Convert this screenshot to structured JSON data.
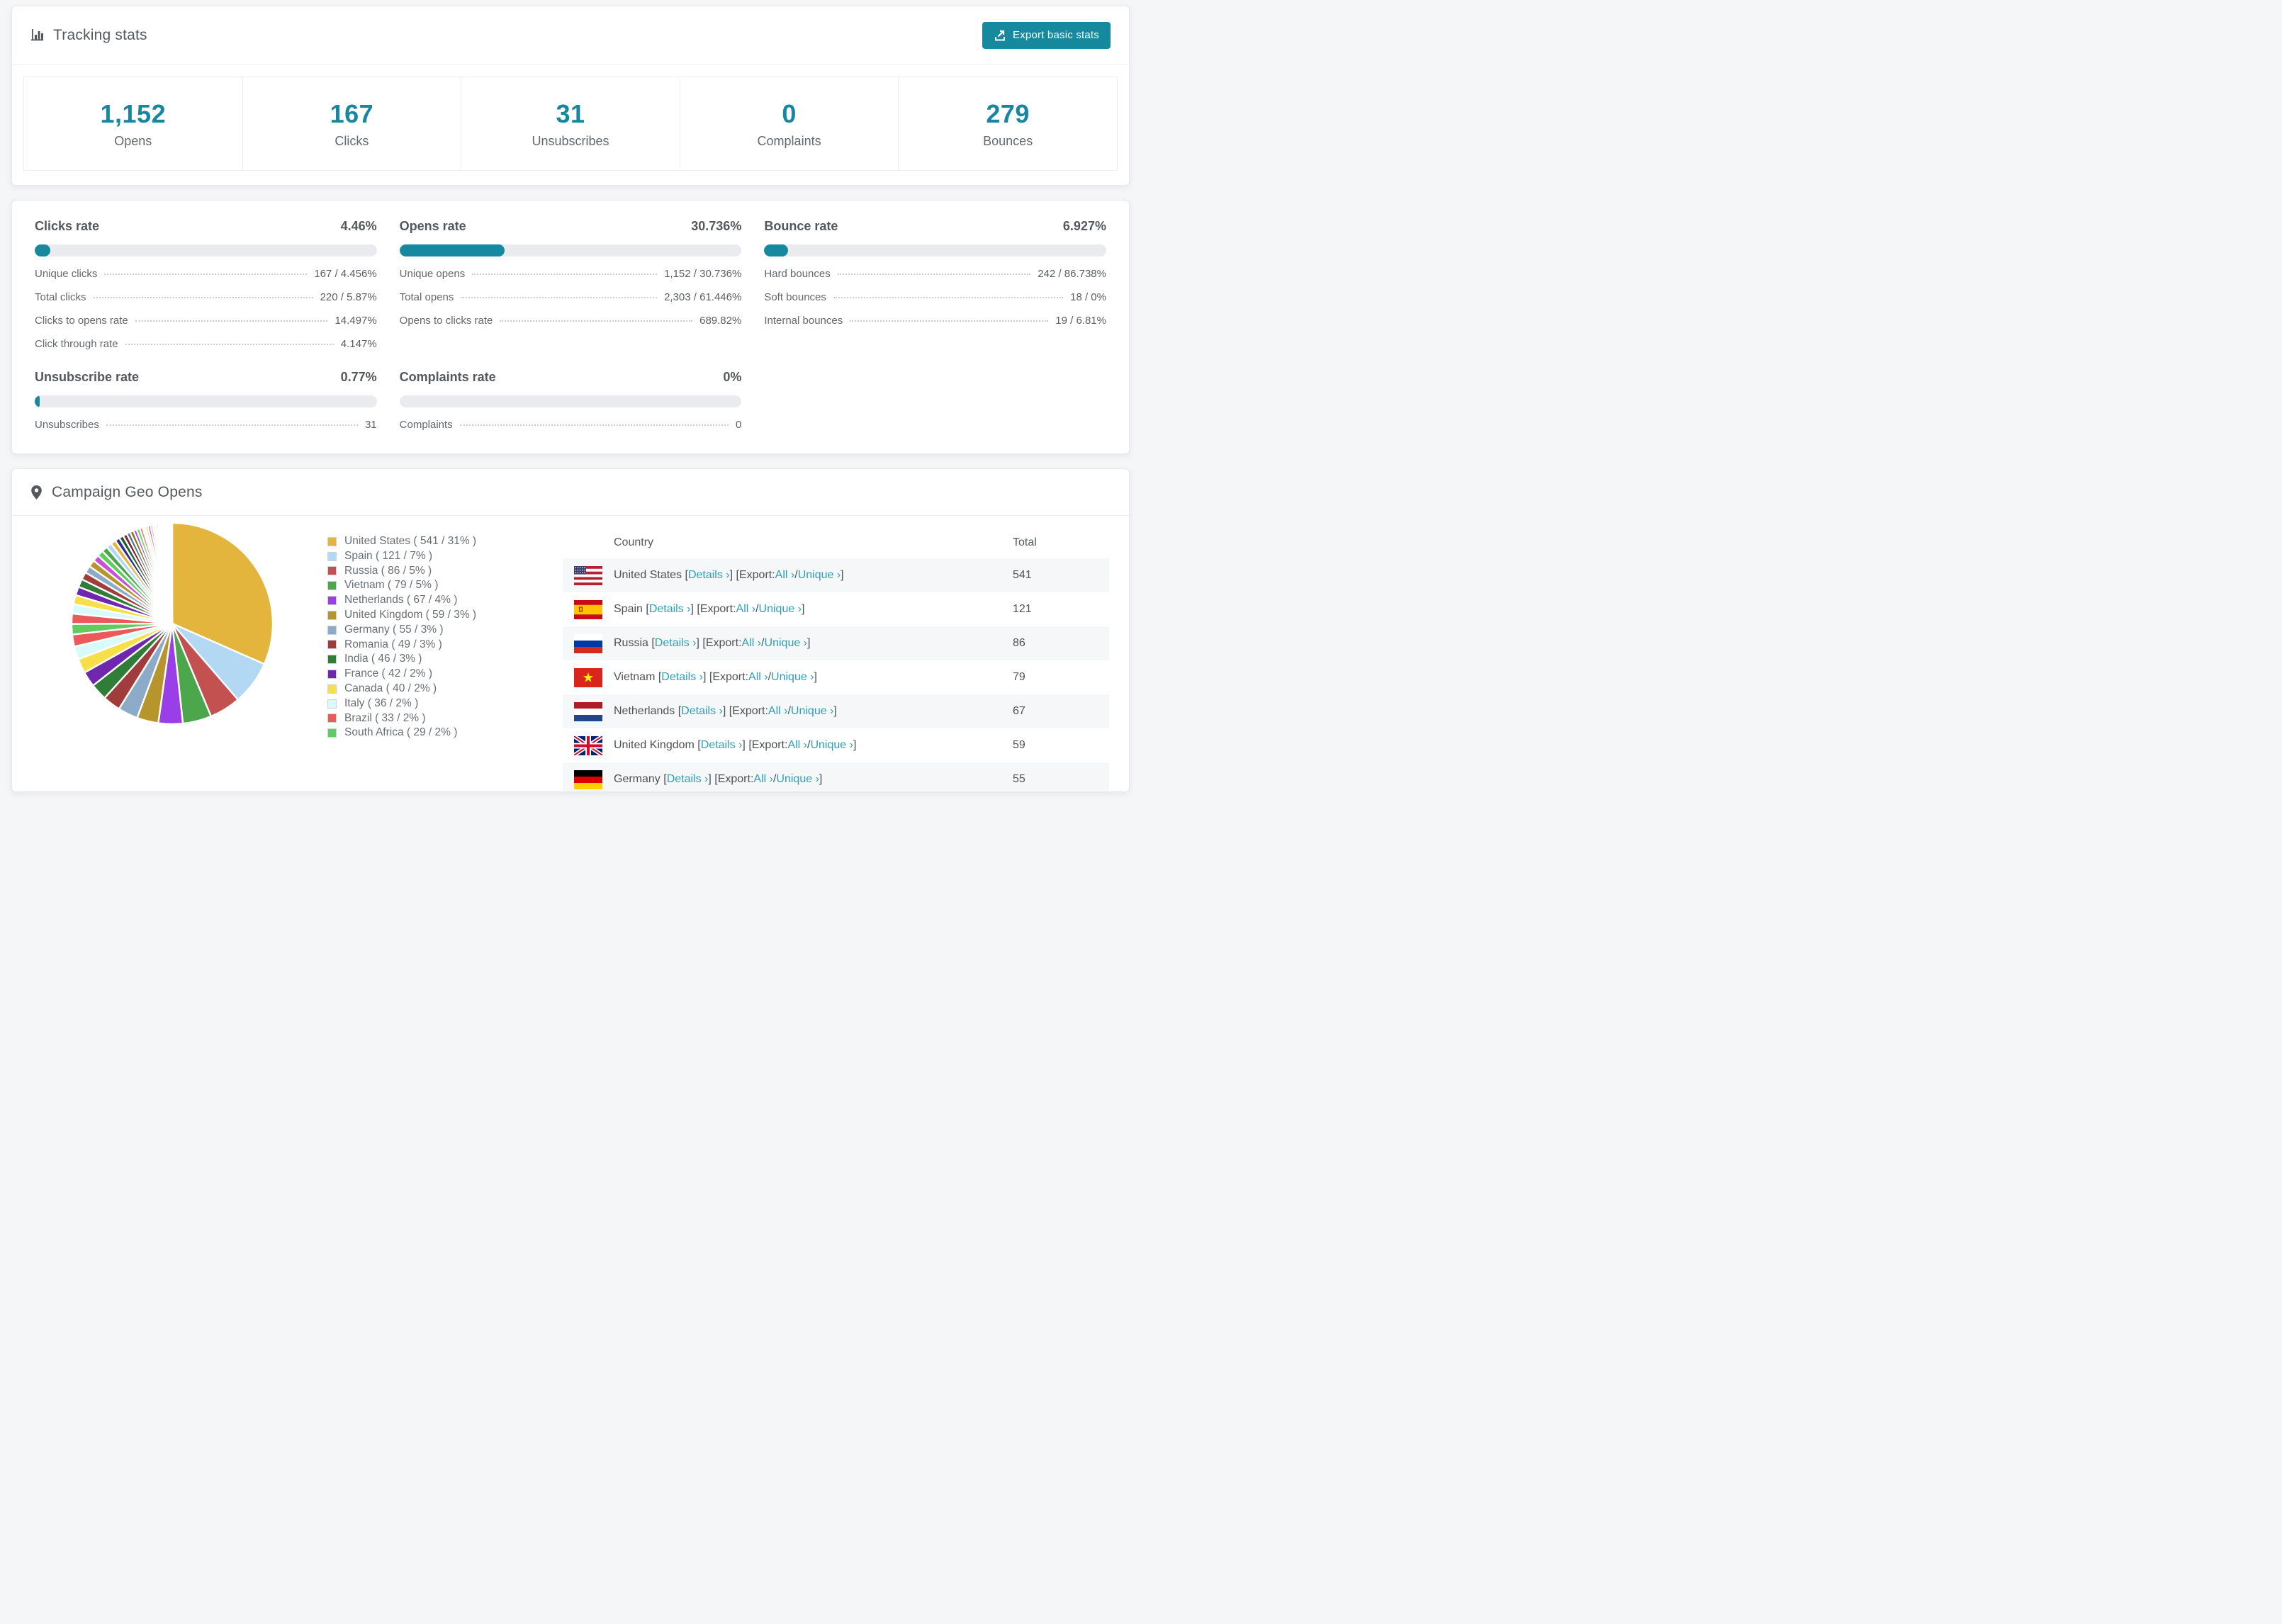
{
  "colors": {
    "accent": "#17899e",
    "link": "#2aa1b7",
    "track": "#e9ebee",
    "page_bg": "#f5f6f8"
  },
  "header": {
    "title": "Tracking stats",
    "export_label": "Export basic stats"
  },
  "summary": [
    {
      "value": "1,152",
      "label": "Opens"
    },
    {
      "value": "167",
      "label": "Clicks"
    },
    {
      "value": "31",
      "label": "Unsubscribes"
    },
    {
      "value": "0",
      "label": "Complaints"
    },
    {
      "value": "279",
      "label": "Bounces"
    }
  ],
  "rates": [
    {
      "title": "Clicks rate",
      "display": "4.46%",
      "pct": 4.46,
      "rows": [
        {
          "label": "Unique clicks",
          "value": "167 / 4.456%"
        },
        {
          "label": "Total clicks",
          "value": "220 / 5.87%"
        },
        {
          "label": "Clicks to opens rate",
          "value": "14.497%"
        },
        {
          "label": "Click through rate",
          "value": "4.147%"
        }
      ]
    },
    {
      "title": "Opens rate",
      "display": "30.736%",
      "pct": 30.736,
      "rows": [
        {
          "label": "Unique opens",
          "value": "1,152 / 30.736%"
        },
        {
          "label": "Total opens",
          "value": "2,303 / 61.446%"
        },
        {
          "label": "Opens to clicks rate",
          "value": "689.82%"
        }
      ]
    },
    {
      "title": "Bounce rate",
      "display": "6.927%",
      "pct": 6.927,
      "rows": [
        {
          "label": "Hard bounces",
          "value": "242 / 86.738%"
        },
        {
          "label": "Soft bounces",
          "value": "18 / 0%"
        },
        {
          "label": "Internal bounces",
          "value": "19 / 6.81%"
        }
      ]
    },
    {
      "title": "Unsubscribe rate",
      "display": "0.77%",
      "pct": 0.77,
      "rows": [
        {
          "label": "Unsubscribes",
          "value": "31"
        }
      ]
    },
    {
      "title": "Complaints rate",
      "display": "0%",
      "pct": 0,
      "rows": [
        {
          "label": "Complaints",
          "value": "0"
        }
      ]
    }
  ],
  "geo": {
    "title": "Campaign Geo Opens",
    "columns": [
      "Country",
      "Total"
    ],
    "link_parts": {
      "pre": "[",
      "details": "Details ›",
      "mid": "] [Export: ",
      "all": "All ›",
      "slash": " / ",
      "unique": "Unique ›",
      "post": "]"
    },
    "table_rows": [
      {
        "name": "United States",
        "flag": "us",
        "total": "541"
      },
      {
        "name": "Spain",
        "flag": "es",
        "total": "121"
      },
      {
        "name": "Russia",
        "flag": "ru",
        "total": "86"
      },
      {
        "name": "Vietnam",
        "flag": "vn",
        "total": "79"
      },
      {
        "name": "Netherlands",
        "flag": "nl",
        "total": "67"
      },
      {
        "name": "United Kingdom",
        "flag": "gb",
        "total": "59"
      },
      {
        "name": "Germany",
        "flag": "de",
        "total": "55"
      }
    ]
  },
  "chart_data": {
    "type": "pie",
    "title": "Campaign Geo Opens",
    "legend_position": "right",
    "slices": [
      {
        "label": "United States",
        "value": 541,
        "pct": 31,
        "color": "#e3b53c"
      },
      {
        "label": "Spain",
        "value": 121,
        "pct": 7,
        "color": "#b3d8f3"
      },
      {
        "label": "Russia",
        "value": 86,
        "pct": 5,
        "color": "#c25150"
      },
      {
        "label": "Vietnam",
        "value": 79,
        "pct": 5,
        "color": "#4ca64c"
      },
      {
        "label": "Netherlands",
        "value": 67,
        "pct": 4,
        "color": "#9a3fe8"
      },
      {
        "label": "United Kingdom",
        "value": 59,
        "pct": 3,
        "color": "#b6952c"
      },
      {
        "label": "Germany",
        "value": 55,
        "pct": 3,
        "color": "#8cabc8"
      },
      {
        "label": "Romania",
        "value": 49,
        "pct": 3,
        "color": "#a03c3c"
      },
      {
        "label": "India",
        "value": 46,
        "pct": 3,
        "color": "#2f7d36"
      },
      {
        "label": "France",
        "value": 42,
        "pct": 2,
        "color": "#6f28ad"
      },
      {
        "label": "Canada",
        "value": 40,
        "pct": 2,
        "color": "#f7df49"
      },
      {
        "label": "Italy",
        "value": 36,
        "pct": 2,
        "color": "#d8fbfa"
      },
      {
        "label": "Brazil",
        "value": 33,
        "pct": 2,
        "color": "#ea5a5a"
      },
      {
        "label": "South Africa",
        "value": 29,
        "pct": 2,
        "color": "#5ecc5e"
      }
    ],
    "others_estimated": {
      "values": [
        28,
        26,
        25,
        24,
        22,
        21,
        20,
        19,
        18,
        17,
        16,
        15,
        14,
        13,
        12,
        11,
        10,
        10,
        9,
        9,
        8,
        8,
        7,
        7,
        6,
        6,
        5,
        5,
        4,
        4,
        4,
        3,
        3,
        3,
        2,
        2,
        2,
        2,
        2,
        1,
        1,
        1,
        1,
        1,
        1,
        1
      ],
      "palette": [
        "#ea5a5a",
        "#d8fbfa",
        "#f7df49",
        "#6f28ad",
        "#2f7d36",
        "#a03c3c",
        "#8cabc8",
        "#b6952c",
        "#c94fd9",
        "#5ecc5e",
        "#4ca64c",
        "#b3d8f3",
        "#e3b53c",
        "#332d8f",
        "#1e5c2e",
        "#7a2430",
        "#50708c",
        "#857416",
        "#b14fe0",
        "#57e057",
        "#ff6b6b",
        "#e8fbff",
        "#f5e642",
        "#9a3fe8"
      ]
    }
  }
}
